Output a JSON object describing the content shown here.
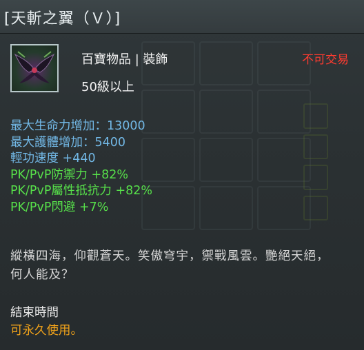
{
  "title": "[天斬之翼（Ｖ）]",
  "item": {
    "icon": "wings-item-icon",
    "category": "百寶物品 | 裝飾",
    "trade_status": "不可交易",
    "level_requirement": "50級以上"
  },
  "stats": [
    {
      "text": "最大生命力增加：13000",
      "color": "blue"
    },
    {
      "text": "最大護體增加：5400",
      "color": "blue"
    },
    {
      "text": "輕功速度 +440",
      "color": "blue"
    },
    {
      "text": "PK/PvP防禦力 +82%",
      "color": "green"
    },
    {
      "text": "PK/PvP屬性抵抗力 +82%",
      "color": "green"
    },
    {
      "text": "PK/PvP閃避 +7%",
      "color": "green"
    }
  ],
  "description": "縱橫四海，仰觀蒼天。笑傲穹宇，禦戰風雲。艷絕天絕，何人能及？",
  "end_time": {
    "label": "結束時間",
    "value": "可永久使用。"
  },
  "colors": {
    "stat_blue": "#72b8e6",
    "stat_green": "#57e04a",
    "trade_red": "#ff3b30",
    "end_value_orange": "#f0a21a"
  }
}
